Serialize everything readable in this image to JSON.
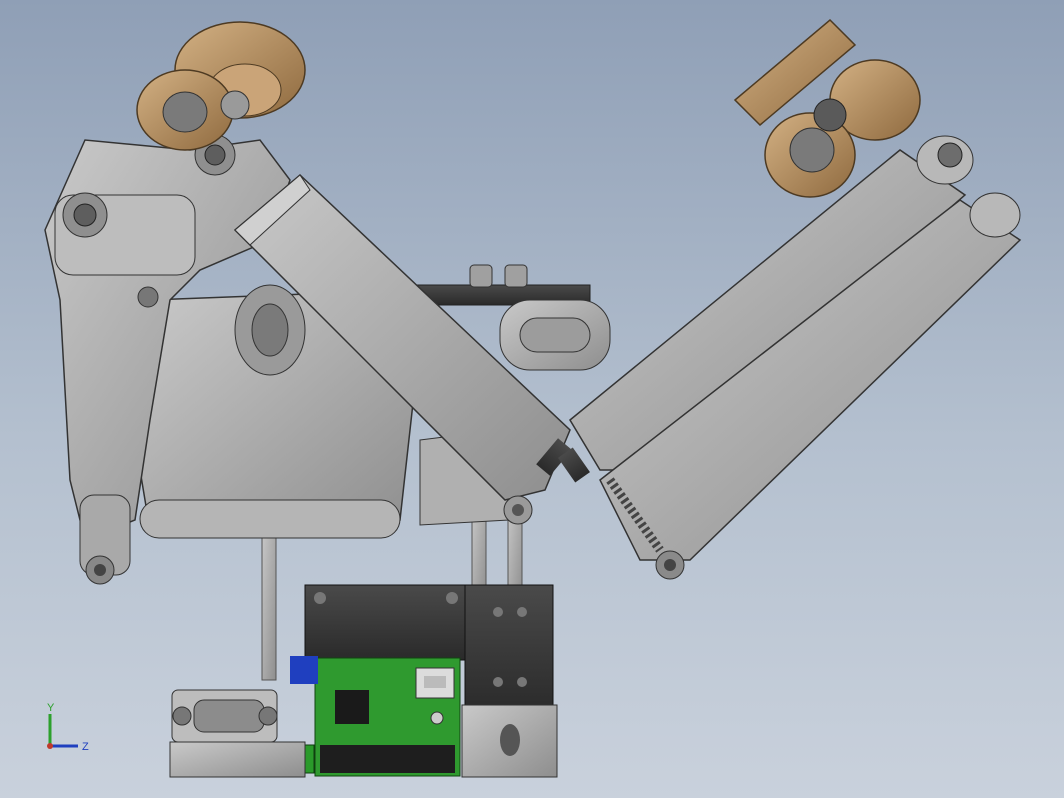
{
  "viewport": {
    "background_top": "#8f9fb6",
    "background_bottom": "#c9d1dc"
  },
  "model": {
    "part_gray": "#a7a7a7",
    "part_gray_dark": "#6b6b6b",
    "bronze": "#b58a5a",
    "pcb_green": "#2f9a2f",
    "black": "#2a2a2a"
  },
  "triad": {
    "y_label": "Y",
    "z_label": "Z",
    "y_color": "#2ca02c",
    "z_color": "#1f3fbf",
    "x_color": "#c0392b"
  }
}
